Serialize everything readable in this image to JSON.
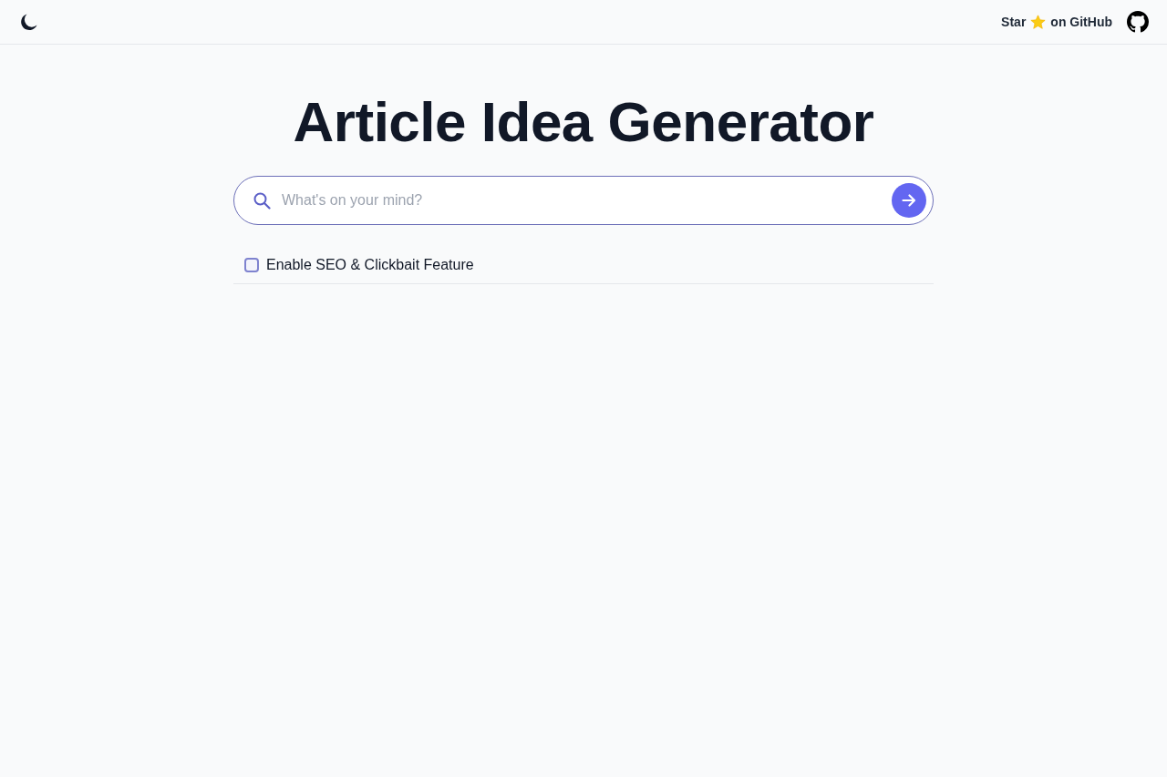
{
  "header": {
    "star_link": {
      "text_before": "Star",
      "text_after": "on GitHub"
    }
  },
  "title": "Article Idea Generator",
  "search": {
    "placeholder": "What's on your mind?"
  },
  "options": [
    {
      "kind": "checkbox",
      "label": "Enable SEO & Clickbait Feature",
      "checked": false
    }
  ]
}
